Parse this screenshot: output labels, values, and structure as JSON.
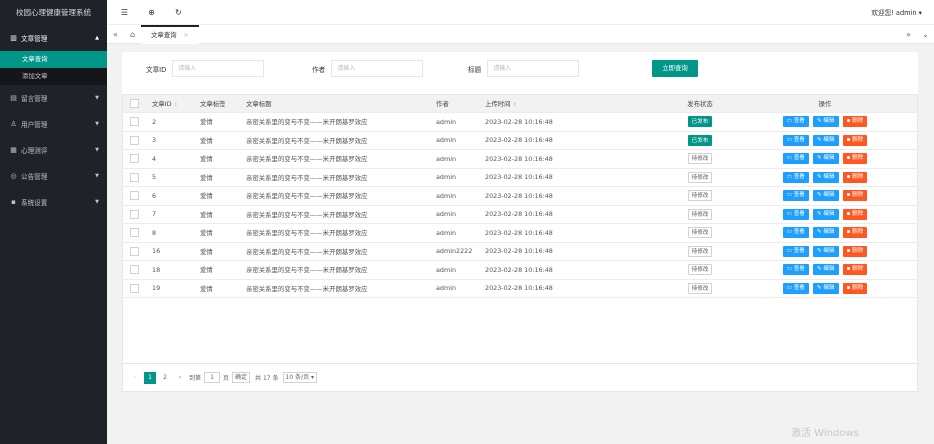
{
  "app": {
    "title": "校园心理健康管理系统"
  },
  "sidebar": {
    "menus": [
      {
        "icon": "book-icon",
        "label": "文章管理",
        "open": true,
        "items": [
          {
            "label": "文章查询",
            "active": true
          },
          {
            "label": "添加文章",
            "active": false
          }
        ]
      },
      {
        "icon": "note-icon",
        "label": "留言管理"
      },
      {
        "icon": "user-icon",
        "label": "用户管理"
      },
      {
        "icon": "test-icon",
        "label": "心理测评"
      },
      {
        "icon": "notice-icon",
        "label": "公告管理"
      },
      {
        "icon": "settings-icon",
        "label": "系统设置"
      }
    ]
  },
  "header": {
    "welcome": "欢迎您! admin ▾"
  },
  "tabs": {
    "active_tab": "文章查询"
  },
  "search": {
    "id_label": "文章ID",
    "id_placeholder": "请输入",
    "author_label": "作者",
    "author_placeholder": "请输入",
    "title_label": "标题",
    "title_placeholder": "请输入",
    "submit_label": "立即查询"
  },
  "table": {
    "headers": {
      "id": "文章ID",
      "tag": "文章标签",
      "title": "文章标题",
      "author": "作者",
      "time": "上传时间",
      "status": "发布状态",
      "ops": "操作"
    },
    "ops": {
      "view": "查看",
      "edit": "编辑",
      "del": "删除"
    },
    "rows": [
      {
        "id": "2",
        "tag": "爱情",
        "title": "亲密关系里的变与不变——米开朗基罗效应",
        "author": "admin",
        "time": "2023-02-28 10:16:48",
        "status": "已发布",
        "published": true
      },
      {
        "id": "3",
        "tag": "爱情",
        "title": "亲密关系里的变与不变——米开朗基罗效应",
        "author": "admin",
        "time": "2023-02-28 10:16:48",
        "status": "已发布",
        "published": true
      },
      {
        "id": "4",
        "tag": "爱情",
        "title": "亲密关系里的变与不变——米开朗基罗效应",
        "author": "admin",
        "time": "2023-02-28 10:16:48",
        "status": "待修改",
        "published": false
      },
      {
        "id": "5",
        "tag": "爱情",
        "title": "亲密关系里的变与不变——米开朗基罗效应",
        "author": "admin",
        "time": "2023-02-28 10:16:48",
        "status": "待修改",
        "published": false
      },
      {
        "id": "6",
        "tag": "爱情",
        "title": "亲密关系里的变与不变——米开朗基罗效应",
        "author": "admin",
        "time": "2023-02-28 10:16:48",
        "status": "待修改",
        "published": false
      },
      {
        "id": "7",
        "tag": "爱情",
        "title": "亲密关系里的变与不变——米开朗基罗效应",
        "author": "admin",
        "time": "2023-02-28 10:16:48",
        "status": "待修改",
        "published": false
      },
      {
        "id": "8",
        "tag": "爱情",
        "title": "亲密关系里的变与不变——米开朗基罗效应",
        "author": "admin",
        "time": "2023-02-28 10:16:48",
        "status": "待修改",
        "published": false
      },
      {
        "id": "16",
        "tag": "爱情",
        "title": "亲密关系里的变与不变——米开朗基罗效应",
        "author": "admin2222",
        "time": "2023-02-28 10:16:48",
        "status": "待修改",
        "published": false
      },
      {
        "id": "18",
        "tag": "爱情",
        "title": "亲密关系里的变与不变——米开朗基罗效应",
        "author": "admin",
        "time": "2023-02-28 10:16:48",
        "status": "待修改",
        "published": false
      },
      {
        "id": "19",
        "tag": "爱情",
        "title": "亲密关系里的变与不变——米开朗基罗效应",
        "author": "admin",
        "time": "2023-02-28 10:16:48",
        "status": "待修改",
        "published": false
      }
    ]
  },
  "pager": {
    "prev": "‹",
    "pages": [
      "1",
      "2"
    ],
    "next": "›",
    "goto_label": "到第",
    "page_input": "1",
    "page_unit": "页",
    "confirm": "确定",
    "total": "共 17 条",
    "page_size": "10 条/页 ▾"
  },
  "watermark": "激活 Windows"
}
